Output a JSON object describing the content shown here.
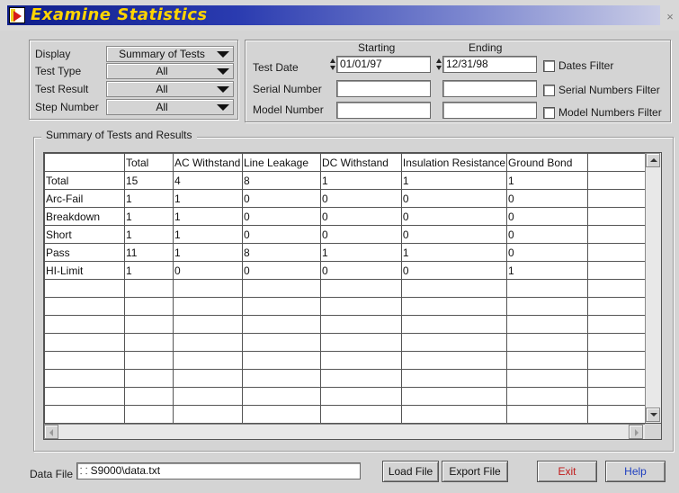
{
  "window": {
    "title": "Examine Statistics",
    "close_glyph": "×"
  },
  "filters": {
    "display_label": "Display",
    "display_value": "Summary of Tests",
    "test_type_label": "Test Type",
    "test_type_value": "All",
    "test_result_label": "Test Result",
    "test_result_value": "All",
    "step_number_label": "Step Number",
    "step_number_value": "All"
  },
  "date_panel": {
    "starting_label": "Starting",
    "ending_label": "Ending",
    "test_date_label": "Test Date",
    "start_date": "01/01/97",
    "end_date": "12/31/98",
    "serial_number_label": "Serial Number",
    "model_number_label": "Model Number",
    "dates_filter_label": "Dates Filter",
    "serial_filter_label": "Serial Numbers Filter",
    "model_filter_label": "Model Numbers Filter"
  },
  "summary": {
    "group_title": "Summary of Tests and Results",
    "columns": [
      "",
      "Total",
      "AC Withstand",
      "Line Leakage",
      "DC Withstand",
      "Insulation Resistance",
      "Ground Bond",
      ""
    ],
    "rows": [
      [
        "Total",
        "15",
        "4",
        "8",
        "1",
        "1",
        "1",
        ""
      ],
      [
        "Arc-Fail",
        "1",
        "1",
        "0",
        "0",
        "0",
        "0",
        ""
      ],
      [
        "Breakdown",
        "1",
        "1",
        "0",
        "0",
        "0",
        "0",
        ""
      ],
      [
        "Short",
        "1",
        "1",
        "0",
        "0",
        "0",
        "0",
        ""
      ],
      [
        "Pass",
        "11",
        "1",
        "8",
        "1",
        "1",
        "0",
        ""
      ],
      [
        "HI-Limit",
        "1",
        "0",
        "0",
        "0",
        "0",
        "1",
        ""
      ]
    ],
    "empty_rows": 8
  },
  "footer": {
    "data_file_label": "Data File",
    "data_file_path": "S9000\\data.txt",
    "load_file": "Load File",
    "export_file": "Export File",
    "exit": "Exit",
    "help": "Help"
  }
}
